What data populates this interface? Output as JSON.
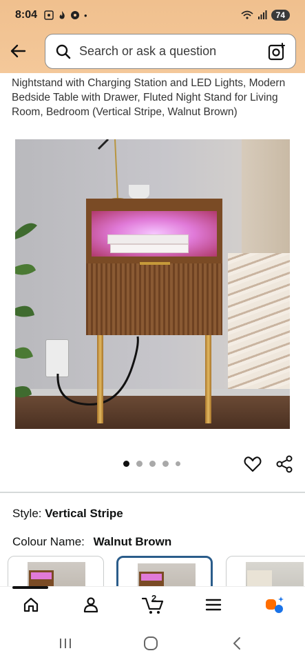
{
  "status_bar": {
    "time": "8:04",
    "battery": "74"
  },
  "search": {
    "placeholder": "Search or ask a question"
  },
  "product": {
    "title": "Nightstand with Charging Station and LED Lights, Modern Bedside Table with Drawer, Fluted Night Stand for Living Room, Bedroom (Vertical Stripe, Walnut Brown)"
  },
  "gallery": {
    "dots_count": 5,
    "active_index": 0
  },
  "variations": {
    "style_label": "Style:",
    "style_value": "Vertical Stripe",
    "colour_label": "Colour Name:",
    "colour_value": "Walnut Brown"
  },
  "bottom_nav": {
    "cart_count": "2"
  },
  "colors": {
    "header_bg": "#f4c89a",
    "selected_border": "#2a5c8a",
    "rufus_blue": "#1a73e8",
    "rufus_orange": "#ff6d00"
  }
}
